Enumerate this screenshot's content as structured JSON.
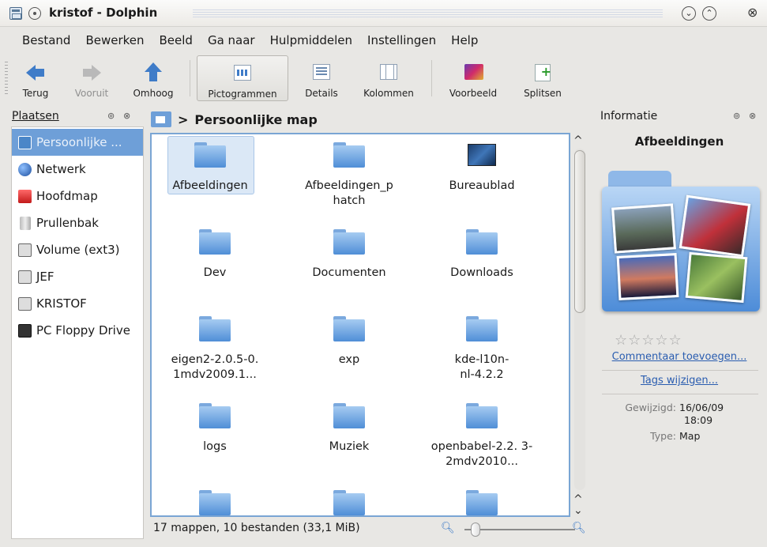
{
  "window": {
    "title": "kristof - Dolphin"
  },
  "menu": [
    "Bestand",
    "Bewerken",
    "Beeld",
    "Ga naar",
    "Hulpmiddelen",
    "Instellingen",
    "Help"
  ],
  "toolbar": {
    "back": "Terug",
    "forward": "Vooruit",
    "up": "Omhoog",
    "icons_view": "Pictogrammen",
    "details_view": "Details",
    "columns_view": "Kolommen",
    "preview": "Voorbeeld",
    "split": "Splitsen"
  },
  "places": {
    "title": "Plaatsen",
    "items": [
      {
        "label": "Persoonlijke ...",
        "icon": "home-icon",
        "selected": true
      },
      {
        "label": "Netwerk",
        "icon": "network-icon"
      },
      {
        "label": "Hoofdmap",
        "icon": "root-folder-icon"
      },
      {
        "label": "Prullenbak",
        "icon": "trash-icon"
      },
      {
        "label": "Volume (ext3)",
        "icon": "drive-icon"
      },
      {
        "label": "JEF",
        "icon": "drive-icon"
      },
      {
        "label": "KRISTOF",
        "icon": "drive-icon"
      },
      {
        "label": "PC Floppy Drive",
        "icon": "floppy-icon"
      }
    ]
  },
  "breadcrumb": {
    "separator": ">",
    "current": "Persoonlijke map"
  },
  "files": [
    {
      "label": "Afbeeldingen",
      "type": "folder",
      "selected": true
    },
    {
      "label": "Afbeeldingen_p hatch",
      "type": "folder"
    },
    {
      "label": "Bureaublad",
      "type": "desktop"
    },
    {
      "label": "Dev",
      "type": "folder"
    },
    {
      "label": "Documenten",
      "type": "folder"
    },
    {
      "label": "Downloads",
      "type": "folder"
    },
    {
      "label": "eigen2-2.0.5-0. 1mdv2009.1...",
      "type": "folder"
    },
    {
      "label": "exp",
      "type": "folder"
    },
    {
      "label": "kde-l10n- nl-4.2.2",
      "type": "folder"
    },
    {
      "label": "logs",
      "type": "folder"
    },
    {
      "label": "Muziek",
      "type": "folder"
    },
    {
      "label": "openbabel-2.2. 3-2mdv2010...",
      "type": "folder"
    },
    {
      "label": "",
      "type": "folder"
    },
    {
      "label": "",
      "type": "folder"
    },
    {
      "label": "",
      "type": "folder"
    }
  ],
  "status": {
    "text": "17 mappen, 10 bestanden (33,1 MiB)"
  },
  "info": {
    "panel_title": "Informatie",
    "name": "Afbeeldingen",
    "comment_link": "Commentaar toevoegen...",
    "tags_link": "Tags wijzigen...",
    "modified_label": "Gewijzigd:",
    "modified_date": "16/06/09",
    "modified_time": "18:09",
    "type_label": "Type:",
    "type_value": "Map",
    "rating": 0
  },
  "glyphs": {
    "sticky": "",
    "minimize": "⌄",
    "maximize": "⌃",
    "close": "⊗",
    "panel_float": "⊚",
    "panel_close": "⊗",
    "scroll_up": "^",
    "scroll_down": "⌄",
    "zoom_out": "🔍︎",
    "zoom_in": "🔍︎",
    "stars": "☆☆☆☆☆"
  },
  "colors": {
    "accent": "#6e9fd8",
    "link": "#2a5db0"
  }
}
